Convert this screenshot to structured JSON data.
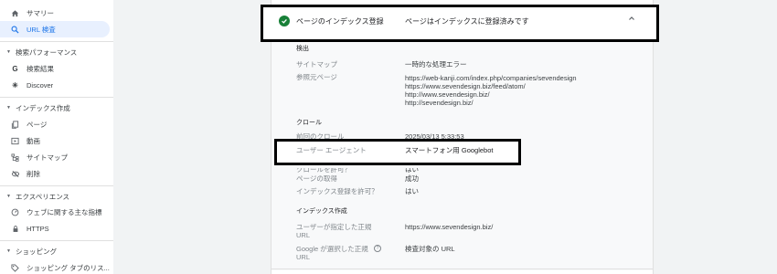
{
  "sidebar": {
    "summary": "サマリー",
    "url_inspection": "URL 検査",
    "sections": {
      "performance": "検索パフォーマンス",
      "indexing": "インデックス作成",
      "experience": "エクスペリエンス",
      "shopping": "ショッピング"
    },
    "items": {
      "search_results": "検索結果",
      "discover": "Discover",
      "pages": "ページ",
      "video": "動画",
      "sitemaps": "サイトマップ",
      "removals": "削除",
      "core_web_vitals": "ウェブに関する主な指標",
      "https": "HTTPS",
      "shopping_tab": "ショッピング タブのリス..."
    }
  },
  "header": {
    "title": "ページのインデックス登録",
    "status": "ページはインデックスに登録済みです"
  },
  "discovery": {
    "section": "検出",
    "sitemap_label": "サイトマップ",
    "sitemap_value": "一時的な処理エラー",
    "referring_label": "参照元ページ",
    "referring_pages": [
      "https://web-kanji.com/index.php/companies/sevendesign",
      "https://www.sevendesign.biz/feed/atom/",
      "http://www.sevendesign.biz/",
      "http://sevendesign.biz/"
    ]
  },
  "crawl": {
    "section": "クロール",
    "last_crawl_label": "前回のクロール",
    "last_crawl_value": "2025/03/13 5:33:53",
    "user_agent_label": "ユーザー エージェント",
    "user_agent_value": "スマートフォン用 Googlebot",
    "crawl_allowed_label": "クロールを許可？",
    "crawl_allowed_value": "はい",
    "fetch_label": "ページの取得",
    "fetch_value": "成功",
    "index_allowed_label": "インデックス登録を許可？",
    "index_allowed_value": "はい"
  },
  "indexing": {
    "section": "インデックス作成",
    "user_canonical_label": "ユーザーが指定した正規",
    "user_canonical_label2": "URL",
    "user_canonical_value": "https://www.sevendesign.biz/",
    "google_canonical_label": "Google が選択した正規",
    "google_canonical_label2": "URL",
    "google_canonical_value": "検査対象の URL"
  },
  "colors": {
    "accent": "#1a73e8",
    "success": "#188038",
    "active_bg": "#e8f0fe"
  }
}
